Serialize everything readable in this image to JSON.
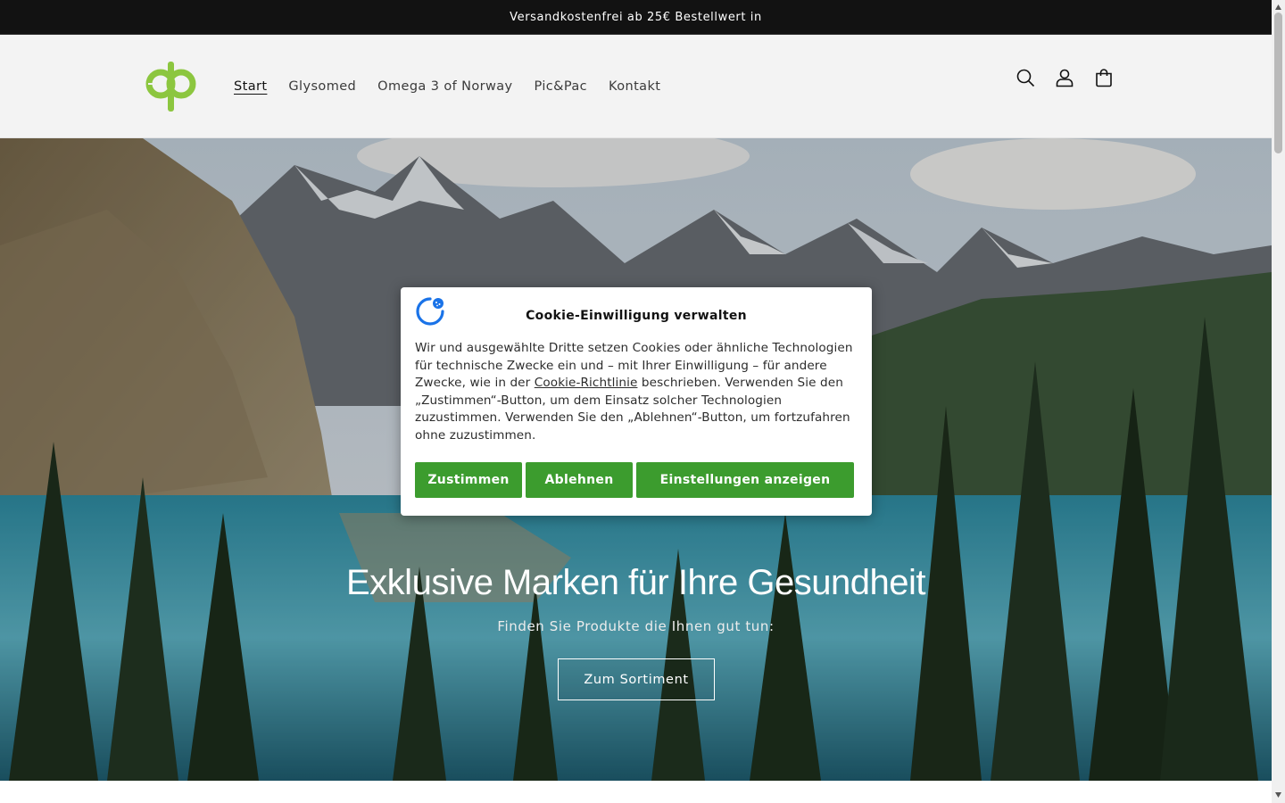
{
  "announcement": {
    "text": "Versandkostenfrei ab 25€ Bestellwert in"
  },
  "header": {
    "logo_icon": "qp-brand-logo",
    "nav": [
      {
        "label": "Start",
        "active": true
      },
      {
        "label": "Glysomed",
        "active": false
      },
      {
        "label": "Omega 3 of Norway",
        "active": false
      },
      {
        "label": "Pic&Pac",
        "active": false
      },
      {
        "label": "Kontakt",
        "active": false
      }
    ],
    "icons": [
      "search-icon",
      "account-icon",
      "cart-icon"
    ]
  },
  "hero": {
    "title": "Exklusive Marken für Ihre Gesundheit",
    "subtitle": "Finden Sie Produkte die Ihnen gut tun:",
    "button_label": "Zum Sortiment",
    "background": "mountain-lake-forest-photo"
  },
  "cookie": {
    "title": "Cookie-Einwilligung verwalten",
    "text_part1": "Wir und ausgewählte Dritte setzen Cookies oder ähnliche Technologien für technische Zwecke ein und – mit Ihrer Einwilligung – für andere Zwecke, wie in der ",
    "link_label": "Cookie-Richtlinie",
    "text_part2": " beschrieben. Verwenden Sie den „Zustimmen“-Button, um dem Einsatz solcher Technologien zuzustimmen. Verwenden Sie den „Ablehnen“-Button, um fortzufahren ohne zuzustimmen.",
    "buttons": {
      "accept": "Zustimmen",
      "reject": "Ablehnen",
      "settings": "Einstellungen anzeigen"
    }
  },
  "colors": {
    "brand_green": "#8cc63f",
    "button_green": "#3c9c2e",
    "announcement_bg": "#121212",
    "header_bg": "#f3f3f3"
  }
}
